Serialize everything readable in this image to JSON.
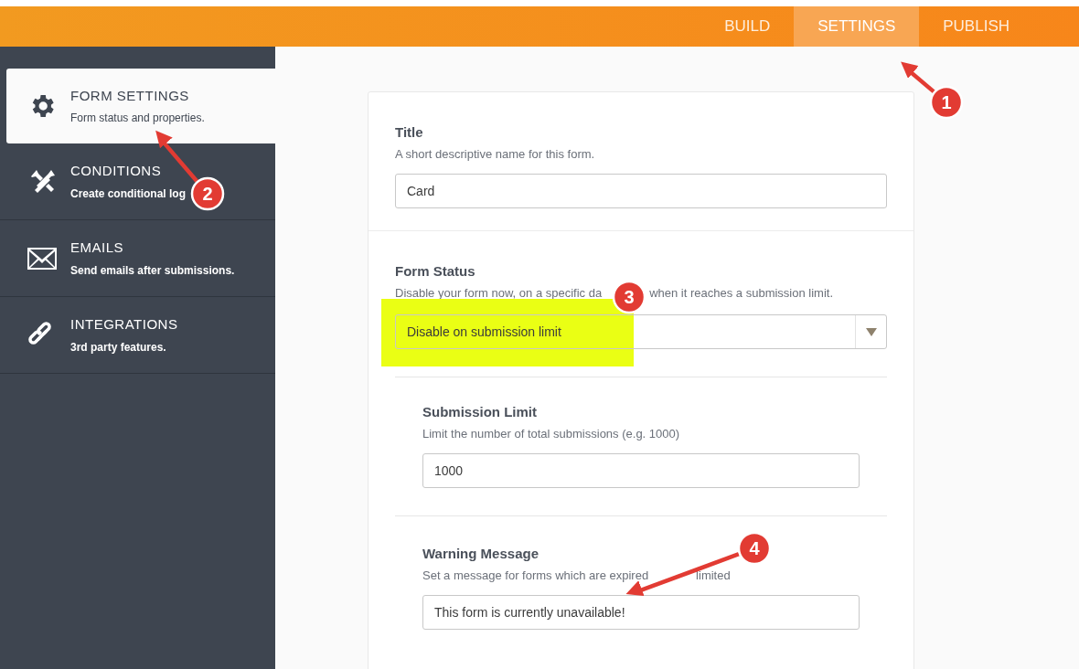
{
  "tabs": [
    {
      "label": "BUILD",
      "selected": false
    },
    {
      "label": "SETTINGS",
      "selected": true
    },
    {
      "label": "PUBLISH",
      "selected": false
    }
  ],
  "sidebar": {
    "items": [
      {
        "title": "FORM SETTINGS",
        "subtitle": "Form status and properties.",
        "selected": true
      },
      {
        "title": "CONDITIONS",
        "subtitle": "Create conditional log",
        "selected": false
      },
      {
        "title": "EMAILS",
        "subtitle": "Send emails after submissions.",
        "selected": false
      },
      {
        "title": "INTEGRATIONS",
        "subtitle": "3rd party features.",
        "selected": false
      }
    ]
  },
  "title_section": {
    "label": "Title",
    "description": "A short descriptive name for this form.",
    "value": "Card"
  },
  "status_section": {
    "label": "Form Status",
    "description_parts": [
      "Disable your form now, on a specific da",
      "when it reaches a submission limit."
    ],
    "selected_option": "Disable on submission limit",
    "submission_limit": {
      "label": "Submission Limit",
      "description": "Limit the number of total submissions (e.g. 1000)",
      "value": "1000"
    },
    "warning_message": {
      "label": "Warning Message",
      "description_parts": [
        "Set a message for forms which are expired",
        "limited"
      ],
      "value": "This form is currently unavailable!"
    }
  },
  "annotations": [
    {
      "label": "1"
    },
    {
      "label": "2"
    },
    {
      "label": "3"
    },
    {
      "label": "4"
    }
  ]
}
